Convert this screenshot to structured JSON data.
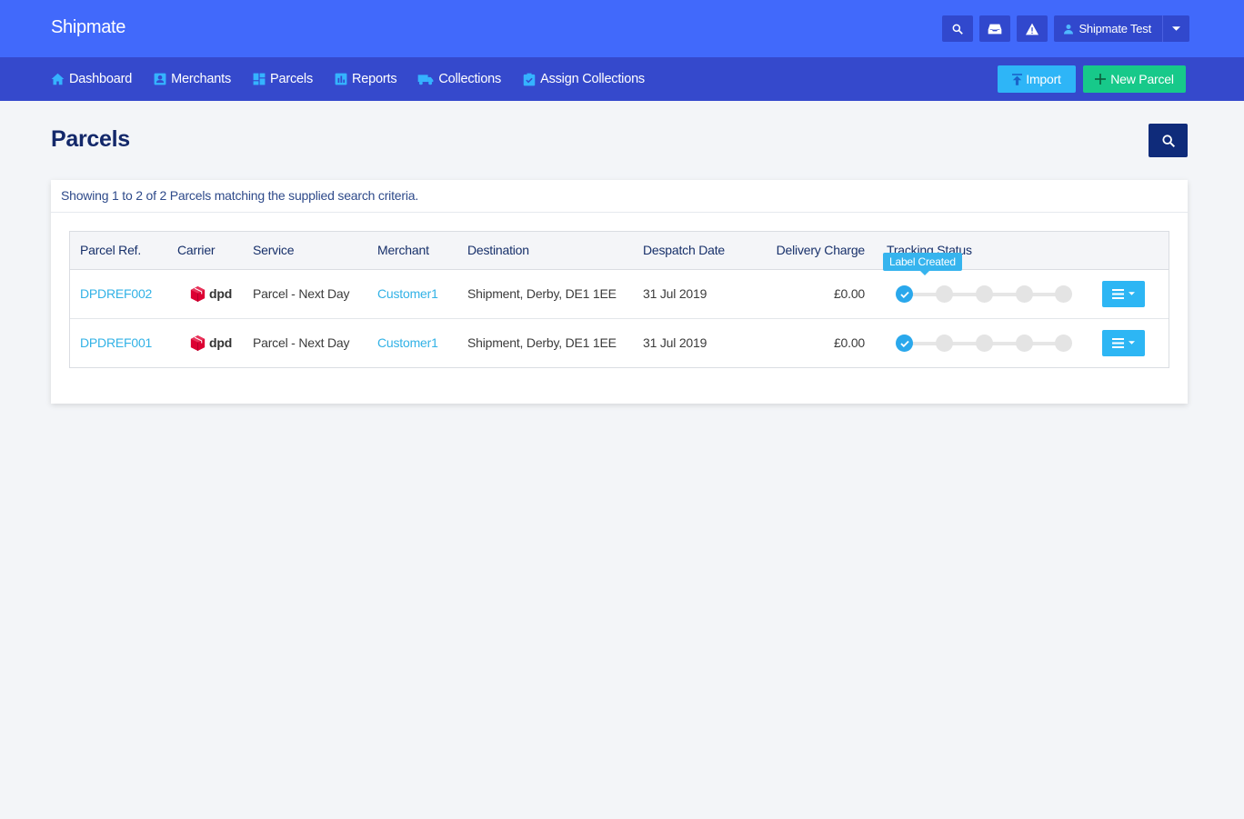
{
  "app": {
    "title": "Shipmate"
  },
  "header": {
    "search_icon": "search-icon",
    "inbox_icon": "inbox-icon",
    "alert_icon": "warning-icon",
    "user_name": "Shipmate Test"
  },
  "nav": {
    "items": [
      {
        "label": "Dashboard",
        "icon": "home-icon"
      },
      {
        "label": "Merchants",
        "icon": "contact-card-icon"
      },
      {
        "label": "Parcels",
        "icon": "dashboard-grid-icon"
      },
      {
        "label": "Reports",
        "icon": "bar-chart-icon"
      },
      {
        "label": "Collections",
        "icon": "truck-icon"
      },
      {
        "label": "Assign Collections",
        "icon": "clipboard-check-icon"
      }
    ],
    "import_label": "Import",
    "new_parcel_label": "New Parcel"
  },
  "page": {
    "title": "Parcels",
    "summary": "Showing 1 to 2 of 2 Parcels matching the supplied search criteria."
  },
  "table": {
    "columns": [
      "Parcel Ref.",
      "Carrier",
      "Service",
      "Merchant",
      "Destination",
      "Despatch Date",
      "Delivery Charge",
      "Tracking Status"
    ],
    "rows": [
      {
        "ref": "DPDREF002",
        "carrier": "dpd",
        "service": "Parcel - Next Day",
        "merchant": "Customer1",
        "destination": "Shipment, Derby, DE1 1EE",
        "date": "31 Jul 2019",
        "charge": "£0.00",
        "tracking_step": 1,
        "tracking_steps": 5,
        "tooltip": "Label Created"
      },
      {
        "ref": "DPDREF001",
        "carrier": "dpd",
        "service": "Parcel - Next Day",
        "merchant": "Customer1",
        "destination": "Shipment, Derby, DE1 1EE",
        "date": "31 Jul 2019",
        "charge": "£0.00",
        "tracking_step": 1,
        "tracking_steps": 5
      }
    ]
  },
  "colors": {
    "primary": "#4169fb",
    "nav": "#3549cc",
    "info": "#2eb5f7",
    "success": "#17c98a",
    "dpd_red": "#dc0032"
  }
}
